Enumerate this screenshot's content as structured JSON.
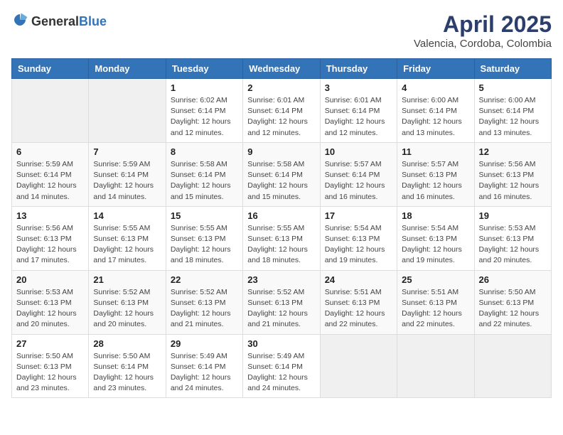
{
  "logo": {
    "general": "General",
    "blue": "Blue"
  },
  "header": {
    "month": "April 2025",
    "location": "Valencia, Cordoba, Colombia"
  },
  "days_of_week": [
    "Sunday",
    "Monday",
    "Tuesday",
    "Wednesday",
    "Thursday",
    "Friday",
    "Saturday"
  ],
  "weeks": [
    [
      {
        "day": "",
        "info": ""
      },
      {
        "day": "",
        "info": ""
      },
      {
        "day": "1",
        "info": "Sunrise: 6:02 AM\nSunset: 6:14 PM\nDaylight: 12 hours\nand 12 minutes."
      },
      {
        "day": "2",
        "info": "Sunrise: 6:01 AM\nSunset: 6:14 PM\nDaylight: 12 hours\nand 12 minutes."
      },
      {
        "day": "3",
        "info": "Sunrise: 6:01 AM\nSunset: 6:14 PM\nDaylight: 12 hours\nand 12 minutes."
      },
      {
        "day": "4",
        "info": "Sunrise: 6:00 AM\nSunset: 6:14 PM\nDaylight: 12 hours\nand 13 minutes."
      },
      {
        "day": "5",
        "info": "Sunrise: 6:00 AM\nSunset: 6:14 PM\nDaylight: 12 hours\nand 13 minutes."
      }
    ],
    [
      {
        "day": "6",
        "info": "Sunrise: 5:59 AM\nSunset: 6:14 PM\nDaylight: 12 hours\nand 14 minutes."
      },
      {
        "day": "7",
        "info": "Sunrise: 5:59 AM\nSunset: 6:14 PM\nDaylight: 12 hours\nand 14 minutes."
      },
      {
        "day": "8",
        "info": "Sunrise: 5:58 AM\nSunset: 6:14 PM\nDaylight: 12 hours\nand 15 minutes."
      },
      {
        "day": "9",
        "info": "Sunrise: 5:58 AM\nSunset: 6:14 PM\nDaylight: 12 hours\nand 15 minutes."
      },
      {
        "day": "10",
        "info": "Sunrise: 5:57 AM\nSunset: 6:14 PM\nDaylight: 12 hours\nand 16 minutes."
      },
      {
        "day": "11",
        "info": "Sunrise: 5:57 AM\nSunset: 6:13 PM\nDaylight: 12 hours\nand 16 minutes."
      },
      {
        "day": "12",
        "info": "Sunrise: 5:56 AM\nSunset: 6:13 PM\nDaylight: 12 hours\nand 16 minutes."
      }
    ],
    [
      {
        "day": "13",
        "info": "Sunrise: 5:56 AM\nSunset: 6:13 PM\nDaylight: 12 hours\nand 17 minutes."
      },
      {
        "day": "14",
        "info": "Sunrise: 5:55 AM\nSunset: 6:13 PM\nDaylight: 12 hours\nand 17 minutes."
      },
      {
        "day": "15",
        "info": "Sunrise: 5:55 AM\nSunset: 6:13 PM\nDaylight: 12 hours\nand 18 minutes."
      },
      {
        "day": "16",
        "info": "Sunrise: 5:55 AM\nSunset: 6:13 PM\nDaylight: 12 hours\nand 18 minutes."
      },
      {
        "day": "17",
        "info": "Sunrise: 5:54 AM\nSunset: 6:13 PM\nDaylight: 12 hours\nand 19 minutes."
      },
      {
        "day": "18",
        "info": "Sunrise: 5:54 AM\nSunset: 6:13 PM\nDaylight: 12 hours\nand 19 minutes."
      },
      {
        "day": "19",
        "info": "Sunrise: 5:53 AM\nSunset: 6:13 PM\nDaylight: 12 hours\nand 20 minutes."
      }
    ],
    [
      {
        "day": "20",
        "info": "Sunrise: 5:53 AM\nSunset: 6:13 PM\nDaylight: 12 hours\nand 20 minutes."
      },
      {
        "day": "21",
        "info": "Sunrise: 5:52 AM\nSunset: 6:13 PM\nDaylight: 12 hours\nand 20 minutes."
      },
      {
        "day": "22",
        "info": "Sunrise: 5:52 AM\nSunset: 6:13 PM\nDaylight: 12 hours\nand 21 minutes."
      },
      {
        "day": "23",
        "info": "Sunrise: 5:52 AM\nSunset: 6:13 PM\nDaylight: 12 hours\nand 21 minutes."
      },
      {
        "day": "24",
        "info": "Sunrise: 5:51 AM\nSunset: 6:13 PM\nDaylight: 12 hours\nand 22 minutes."
      },
      {
        "day": "25",
        "info": "Sunrise: 5:51 AM\nSunset: 6:13 PM\nDaylight: 12 hours\nand 22 minutes."
      },
      {
        "day": "26",
        "info": "Sunrise: 5:50 AM\nSunset: 6:13 PM\nDaylight: 12 hours\nand 22 minutes."
      }
    ],
    [
      {
        "day": "27",
        "info": "Sunrise: 5:50 AM\nSunset: 6:13 PM\nDaylight: 12 hours\nand 23 minutes."
      },
      {
        "day": "28",
        "info": "Sunrise: 5:50 AM\nSunset: 6:14 PM\nDaylight: 12 hours\nand 23 minutes."
      },
      {
        "day": "29",
        "info": "Sunrise: 5:49 AM\nSunset: 6:14 PM\nDaylight: 12 hours\nand 24 minutes."
      },
      {
        "day": "30",
        "info": "Sunrise: 5:49 AM\nSunset: 6:14 PM\nDaylight: 12 hours\nand 24 minutes."
      },
      {
        "day": "",
        "info": ""
      },
      {
        "day": "",
        "info": ""
      },
      {
        "day": "",
        "info": ""
      }
    ]
  ]
}
